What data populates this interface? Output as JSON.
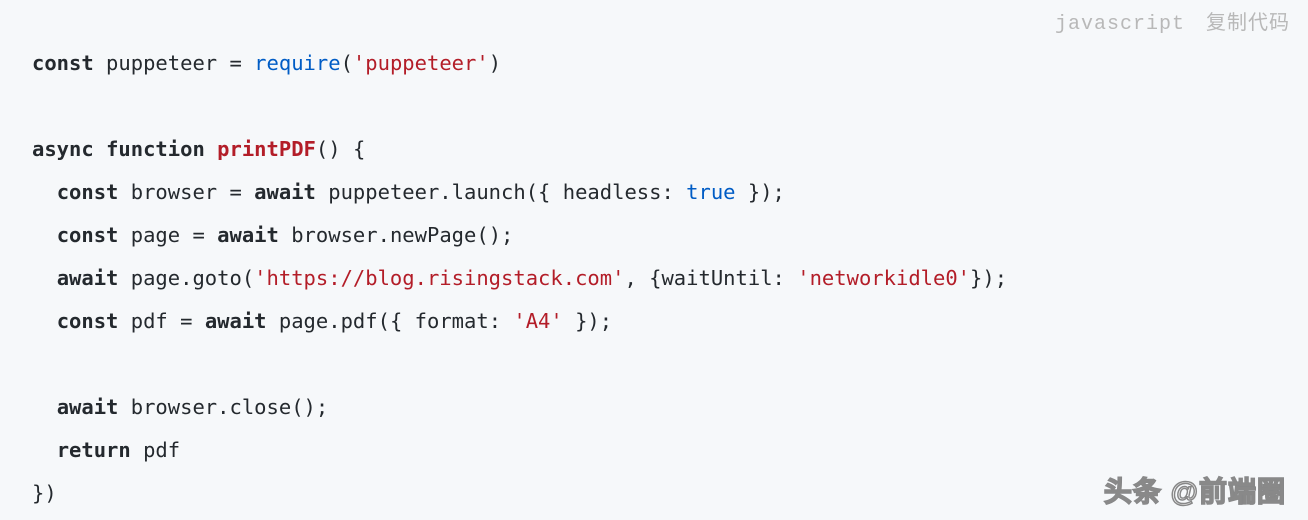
{
  "header": {
    "language": "javascript",
    "copy_label": "复制代码"
  },
  "code": {
    "t1_const": "const",
    "t1_var": " puppeteer ",
    "t1_eq": "= ",
    "t1_require": "require",
    "t1_paren_open": "(",
    "t1_str": "'puppeteer'",
    "t1_paren_close": ")",
    "t3_async": "async",
    "t3_sp1": " ",
    "t3_function": "function",
    "t3_sp2": " ",
    "t3_name": "printPDF",
    "t3_parens": "()",
    "t3_sp3": " ",
    "t3_brace": "{",
    "t4_indent": "  ",
    "t4_const": "const",
    "t4_rest1": " browser = ",
    "t4_await": "await",
    "t4_rest2": " puppeteer.launch({ headless: ",
    "t4_true": "true",
    "t4_rest3": " });",
    "t5_indent": "  ",
    "t5_const": "const",
    "t5_rest1": " page = ",
    "t5_await": "await",
    "t5_rest2": " browser.newPage();",
    "t6_indent": "  ",
    "t6_await": "await",
    "t6_rest1": " page.goto(",
    "t6_str1": "'https://blog.risingstack.com'",
    "t6_rest2": ", {waitUntil: ",
    "t6_str2": "'networkidle0'",
    "t6_rest3": "});",
    "t7_indent": "  ",
    "t7_const": "const",
    "t7_rest1": " pdf = ",
    "t7_await": "await",
    "t7_rest2": " page.pdf({ format: ",
    "t7_str": "'A4'",
    "t7_rest3": " });",
    "t9_indent": "  ",
    "t9_await": "await",
    "t9_rest": " browser.close();",
    "t10_indent": "  ",
    "t10_return": "return",
    "t10_rest": " pdf",
    "t11": "})"
  },
  "watermark": "头条 @前端圈"
}
